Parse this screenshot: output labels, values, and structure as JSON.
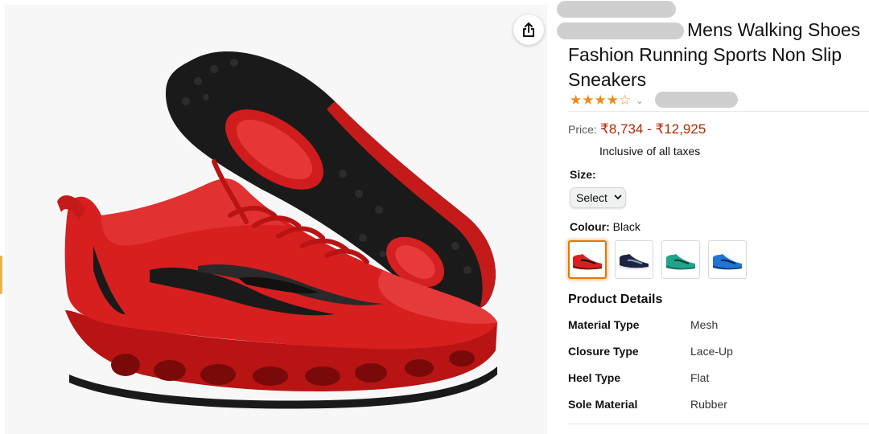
{
  "product": {
    "title": "Mens Walking Shoes Fashion Running Sports Non Slip Sneakers",
    "rating_stars_filled": "★★★★",
    "rating_stars_empty": "☆",
    "rating_chevron": "⌄",
    "price_label": "Price:",
    "price_value": "₹8,734 - ₹12,925",
    "tax_note": "Inclusive of all taxes",
    "size_label": "Size:",
    "size_selected": "Select",
    "colour_label": "Colour:",
    "colour_value": "Black",
    "colour_swatches": [
      {
        "name": "red",
        "color": "#d91f1f",
        "selected": true
      },
      {
        "name": "navy",
        "color": "#1c2340",
        "selected": false
      },
      {
        "name": "teal",
        "color": "#1fa58c",
        "selected": false
      },
      {
        "name": "blue",
        "color": "#1f74d6",
        "selected": false
      }
    ],
    "details_heading": "Product Details",
    "details": [
      {
        "key": "Material Type",
        "value": "Mesh"
      },
      {
        "key": "Closure Type",
        "value": "Lace-Up"
      },
      {
        "key": "Heel Type",
        "value": "Flat"
      },
      {
        "key": "Sole Material",
        "value": "Rubber"
      }
    ]
  },
  "icons": {
    "share": "share-icon"
  },
  "colors": {
    "price": "#b12704",
    "stars": "#f08a1c",
    "swatch_selected_border": "#e77600"
  }
}
